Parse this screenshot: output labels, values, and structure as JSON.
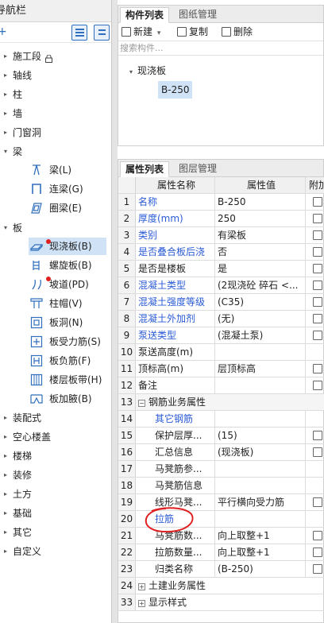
{
  "nav": {
    "title": "导航栏",
    "add_symbol": "+",
    "items": [
      {
        "label": "施工段",
        "has_lock": true
      },
      {
        "label": "轴线"
      },
      {
        "label": "柱"
      },
      {
        "label": "墙"
      },
      {
        "label": "门窗洞"
      },
      {
        "label": "梁"
      },
      {
        "label": "板"
      },
      {
        "label": "装配式"
      },
      {
        "label": "空心楼盖"
      },
      {
        "label": "楼梯"
      },
      {
        "label": "装修"
      },
      {
        "label": "土方"
      },
      {
        "label": "基础"
      },
      {
        "label": "其它"
      },
      {
        "label": "自定义"
      }
    ],
    "beam_children": [
      "梁(L)",
      "连梁(G)",
      "圈梁(E)"
    ],
    "slab_children": [
      "现浇板(B)",
      "螺旋板(B)",
      "坡道(PD)",
      "柱帽(V)",
      "板洞(N)",
      "板受力筋(S)",
      "板负筋(F)",
      "楼层板带(H)",
      "板加腋(B)"
    ]
  },
  "component_panel": {
    "tabs": [
      "构件列表",
      "图纸管理"
    ],
    "toolbar": {
      "new": "新建",
      "new_caret": "▾",
      "copy": "复制",
      "delete": "删除"
    },
    "search_placeholder": "搜索构件...",
    "tree_root": "现浇板",
    "tree_child": "B-250"
  },
  "property_panel": {
    "tabs": [
      "属性列表",
      "图层管理"
    ],
    "headers": {
      "name": "属性名称",
      "value": "属性值",
      "extra": "附加"
    },
    "rows": [
      {
        "num": "1",
        "name": "名称",
        "value": "B-250"
      },
      {
        "num": "2",
        "name": "厚度(mm)",
        "value": "250"
      },
      {
        "num": "3",
        "name": "类别",
        "value": "有梁板"
      },
      {
        "num": "4",
        "name": "是否叠合板后浇",
        "value": "否"
      },
      {
        "num": "5",
        "name": "是否是楼板",
        "value": "是"
      },
      {
        "num": "6",
        "name": "混凝土类型",
        "value": "(2现浇砼 碎石 <..."
      },
      {
        "num": "7",
        "name": "混凝土强度等级",
        "value": "(C35)"
      },
      {
        "num": "8",
        "name": "混凝土外加剂",
        "value": "(无)"
      },
      {
        "num": "9",
        "name": "泵送类型",
        "value": "(混凝土泵)"
      },
      {
        "num": "10",
        "name": "泵送高度(m)",
        "value": ""
      },
      {
        "num": "11",
        "name": "顶标高(m)",
        "value": "层顶标高"
      },
      {
        "num": "12",
        "name": "备注",
        "value": ""
      },
      {
        "num": "13",
        "name": "钢筋业务属性",
        "value": ""
      },
      {
        "num": "14",
        "name": "其它钢筋",
        "value": ""
      },
      {
        "num": "15",
        "name": "保护层厚...",
        "value": "(15)"
      },
      {
        "num": "16",
        "name": "汇总信息",
        "value": "(现浇板)"
      },
      {
        "num": "17",
        "name": "马凳筋参...",
        "value": ""
      },
      {
        "num": "18",
        "name": "马凳筋信息",
        "value": ""
      },
      {
        "num": "19",
        "name": "线形马凳...",
        "value": "平行横向受力筋"
      },
      {
        "num": "20",
        "name": "拉筋",
        "value": ""
      },
      {
        "num": "21",
        "name": "马凳筋数...",
        "value": "向上取整+1"
      },
      {
        "num": "22",
        "name": "拉筋数量...",
        "value": "向上取整+1"
      },
      {
        "num": "23",
        "name": "归类名称",
        "value": "(B-250)"
      },
      {
        "num": "24",
        "name": "土建业务属性",
        "value": ""
      },
      {
        "num": "33",
        "name": "显示样式",
        "value": ""
      }
    ],
    "expand_minus": "−",
    "expand_plus": "+"
  },
  "colors": {
    "link_blue": "#2a5bd7",
    "selection": "#cfe2f6",
    "annotation_red": "#e02020"
  }
}
